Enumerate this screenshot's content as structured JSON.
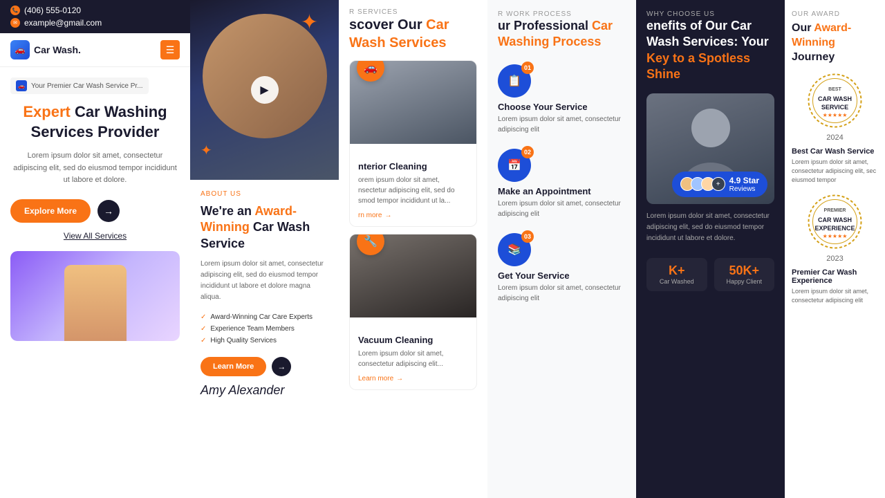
{
  "panel1": {
    "topbar": {
      "phone": "(406) 555-0120",
      "email": "example@gmail.com"
    },
    "logo": "Car Wash.",
    "hero": {
      "breadcrumb": "Your Premier Car Wash Service Pr...",
      "title_accent": "Expert",
      "title_rest": " Car Washing Services Provider",
      "description": "Lorem ipsum dolor sit amet, consectetur adipiscing elit, sed do eiusmod tempor incididunt ut labore et dolore.",
      "btn_explore": "Explore More",
      "btn_view": "View All Services"
    }
  },
  "panel2": {
    "section_tag": "ABOUT US",
    "title_pre": "We're an ",
    "title_accent": "Award-Winning",
    "title_rest": " Car Wash Service",
    "description": "Lorem ipsum dolor sit amet, consectetur adipiscing elit, sed do eiusmod tempor incididunt ut labore et dolore magna aliqua.",
    "features": [
      "Award-Winning Car Care Experts",
      "Experience Team Members",
      "High Quality Services"
    ],
    "btn_learn": "Learn More",
    "signature": "Amy Alexander"
  },
  "panel3": {
    "section_tag": "R SERVICES",
    "title_pre": "scover Our ",
    "title_accent": "Car Wash Services",
    "services": [
      {
        "title": "nterior Cleaning",
        "desc": "orem ipsum dolor sit amet, nsectetur adipiscing elit, sed do smod tempor incididunt ut la...",
        "learn_more": "rn more"
      },
      {
        "title": "Vacuum Cleaning",
        "desc": "Lorem ipsum dolor sit amet, consectetur adipiscing elit...",
        "learn_more": "Learn more"
      }
    ]
  },
  "panel4": {
    "section_tag": "R WORK PROCESS",
    "title_pre": "ur Professional ",
    "title_accent": "Car Washing Process",
    "steps": [
      {
        "number": "01",
        "title": "Choose Your Service",
        "desc": "Lorem ipsum dolor sit amet, consectetur adipiscing elit"
      },
      {
        "number": "02",
        "title": "Make an Appointment",
        "desc": "Lorem ipsum dolor sit amet, consectetur adipiscing elit"
      },
      {
        "number": "03",
        "title": "Get Your Service",
        "desc": "Lorem ipsum dolor sit amet, consectetur adipiscing elit"
      }
    ]
  },
  "panel5": {
    "section_tag": "WHY CHOOSE US",
    "title_pre": "enefits of Our Car Wash Services: Your ",
    "title_accent": "Key to a Spotless Shine",
    "description": "Lorem ipsum dolor sit amet, consectetur adipiscing elit, sed do eiusmod tempor incididunt ut labore et dolore.",
    "rating": {
      "stars": "4.9 Star",
      "label": "Reviews"
    },
    "stats": [
      {
        "number": "K+",
        "label": "Car Washed"
      },
      {
        "number": "50K+",
        "label": "Happy Client"
      }
    ]
  },
  "panel6": {
    "section_tag": "OUR AWARD",
    "title_pre": "Our ",
    "title_accent": "Award-Winning",
    "title_rest": " Journey",
    "awards": [
      {
        "year": "2024",
        "label_top": "BEST",
        "label_main": "CAR WASH\nSERVICE",
        "title": "Best Car Wash Service",
        "desc": "Lorem ipsum dolor sit amet, consectetur adipiscing elit, sec eiusmod tempor"
      },
      {
        "year": "2023",
        "label_top": "PREMIER",
        "label_main": "CAR WASH\nEXPERIENCE",
        "title": "Premier Car Wash Experience",
        "desc": "Lorem ipsum dolor sit amet, consectetur adipiscing elit"
      }
    ]
  }
}
